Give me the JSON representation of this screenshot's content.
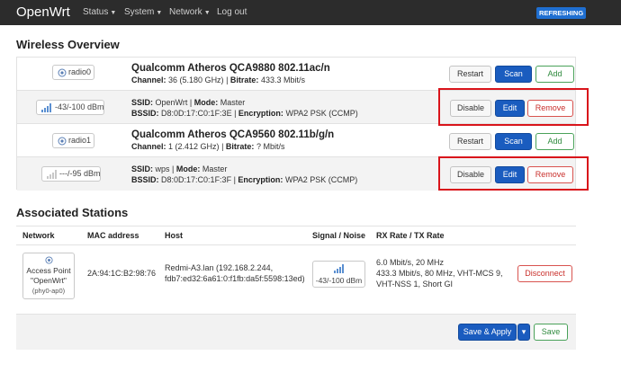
{
  "nav": {
    "brand": "OpenWrt",
    "items": [
      {
        "label": "Status",
        "has_dropdown": true
      },
      {
        "label": "System",
        "has_dropdown": true
      },
      {
        "label": "Network",
        "has_dropdown": true
      },
      {
        "label": "Log out",
        "has_dropdown": false
      }
    ],
    "refresh_badge": "REFRESHING"
  },
  "wireless": {
    "title": "Wireless Overview",
    "radios": [
      {
        "name": "radio0",
        "icon": "wifi-radio-icon",
        "title": "Qualcomm Atheros QCA9880 802.11ac/n",
        "channel_label": "Channel:",
        "channel": "36 (5.180 GHz)",
        "bitrate_label": "Bitrate:",
        "bitrate": "433.3 Mbit/s",
        "buttons": {
          "restart": "Restart",
          "scan": "Scan",
          "add": "Add"
        },
        "network": {
          "signal_icon": "signal-bars-icon",
          "signal": "-43/-100 dBm",
          "ssid_label": "SSID:",
          "ssid": "OpenWrt",
          "mode_label": "Mode:",
          "mode": "Master",
          "bssid_label": "BSSID:",
          "bssid": "D8:0D:17:C0:1F:3E",
          "enc_label": "Encryption:",
          "encryption": "WPA2 PSK (CCMP)",
          "buttons": {
            "disable": "Disable",
            "edit": "Edit",
            "remove": "Remove"
          }
        }
      },
      {
        "name": "radio1",
        "icon": "wifi-radio-icon",
        "title": "Qualcomm Atheros QCA9560 802.11b/g/n",
        "channel_label": "Channel:",
        "channel": "1 (2.412 GHz)",
        "bitrate_label": "Bitrate:",
        "bitrate": "? Mbit/s",
        "buttons": {
          "restart": "Restart",
          "scan": "Scan",
          "add": "Add"
        },
        "network": {
          "signal_icon": "signal-empty-icon",
          "signal": "---/-95 dBm",
          "ssid_label": "SSID:",
          "ssid": "wps",
          "mode_label": "Mode:",
          "mode": "Master",
          "bssid_label": "BSSID:",
          "bssid": "D8:0D:17:C0:1F:3F",
          "enc_label": "Encryption:",
          "encryption": "WPA2 PSK (CCMP)",
          "buttons": {
            "disable": "Disable",
            "edit": "Edit",
            "remove": "Remove"
          }
        }
      }
    ]
  },
  "stations": {
    "title": "Associated Stations",
    "headers": [
      "Network",
      "MAC address",
      "Host",
      "Signal / Noise",
      "RX Rate / TX Rate"
    ],
    "rows": [
      {
        "network_line1": "Access Point",
        "network_line2": "\"OpenWrt\"",
        "network_line3": "(phy0-ap0)",
        "mac": "2A:94:1C:B2:98:76",
        "host_line1": "Redmi-A3.lan (192.168.2.244,",
        "host_line2": "fdb7:ed32:6a61:0:f1fb:da5f:5598:13ed)",
        "signal": "-43/-100 dBm",
        "rate_line1": "6.0 Mbit/s, 20 MHz",
        "rate_line2": "433.3 Mbit/s, 80 MHz, VHT-MCS 9,",
        "rate_line3": "VHT-NSS 1, Short GI",
        "disconnect": "Disconnect"
      }
    ]
  },
  "footer": {
    "save_apply": "Save & Apply",
    "dropdown_caret": "▾",
    "save": "Save"
  },
  "colors": {
    "navbar": "#2c2c2c",
    "primary": "#1a5cbf",
    "positive": "#4aa25a",
    "negative": "#d9534f",
    "highlight": "#d9141b"
  }
}
